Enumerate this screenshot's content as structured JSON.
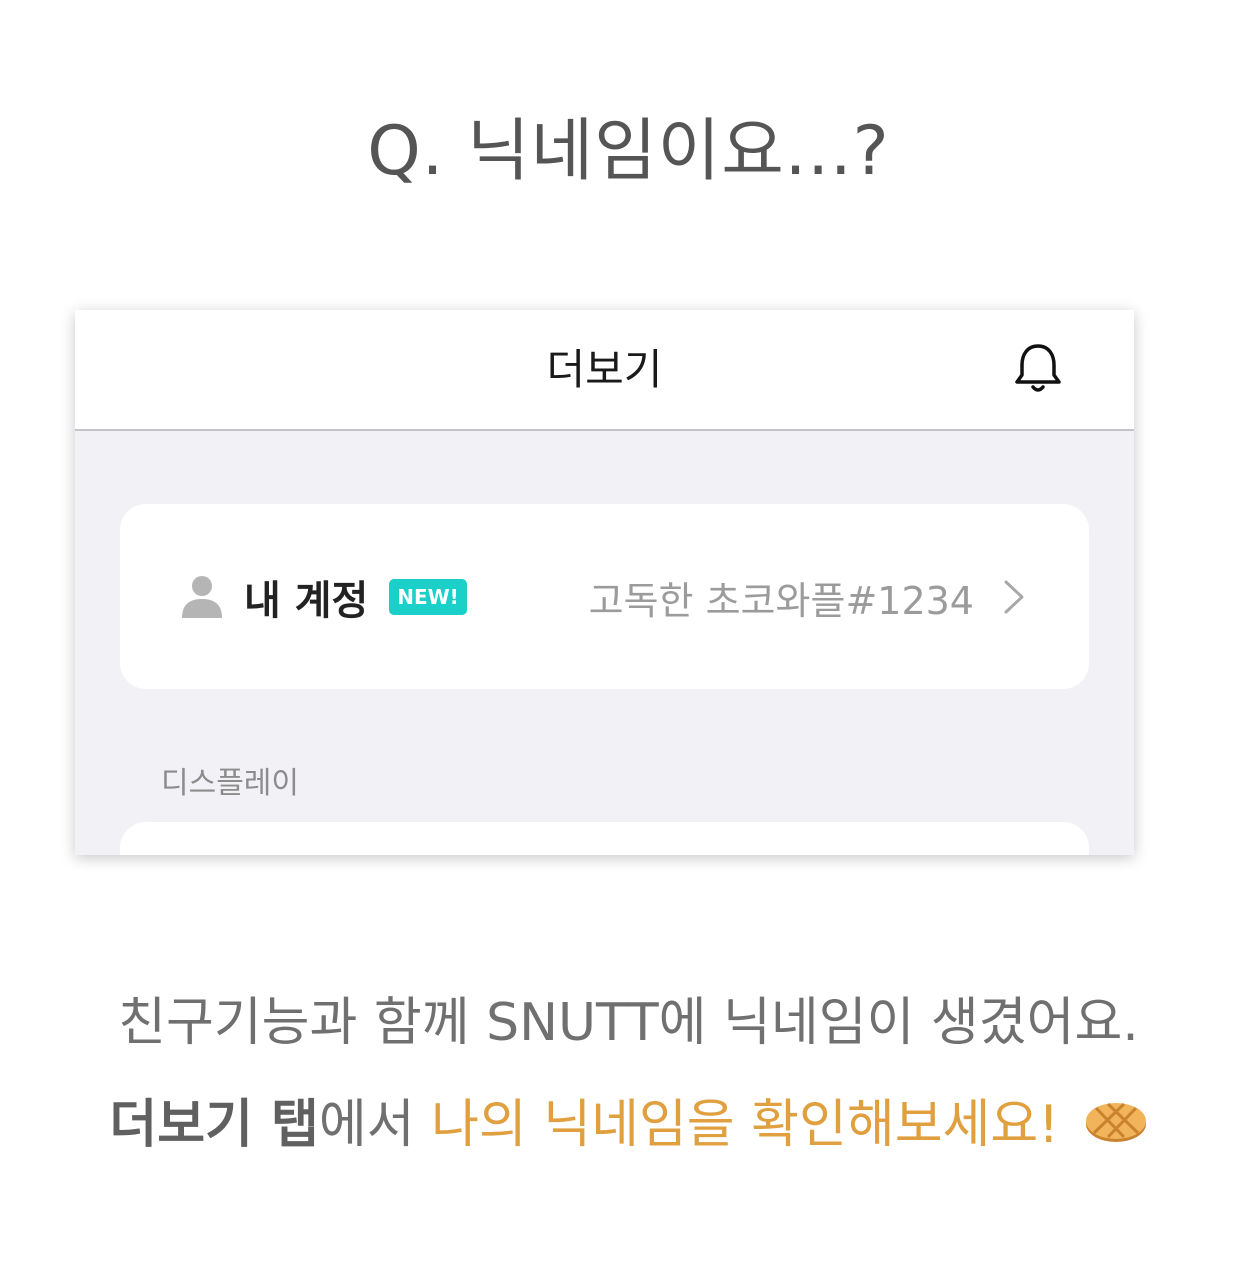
{
  "heading": "Q. 닉네임이요...?",
  "app": {
    "nav_title": "더보기",
    "account": {
      "label": "내 계정",
      "badge": "NEW!",
      "nickname": "고독한 초코와플#1234"
    },
    "section_display_label": "디스플레이"
  },
  "caption": {
    "line1": "친구기능과 함께 SNUTT에 닉네임이 생겼어요.",
    "line2_bold": "더보기 탭",
    "line2_mid": "에서 ",
    "line2_accent": "나의 닉네임을 확인해보세요!"
  },
  "colors": {
    "badge": "#1bd0c8",
    "accent": "#e0a040",
    "background_app": "#f2f2f6"
  },
  "icons": [
    "bell-icon",
    "person-icon",
    "chevron-right-icon",
    "waffle-icon"
  ]
}
